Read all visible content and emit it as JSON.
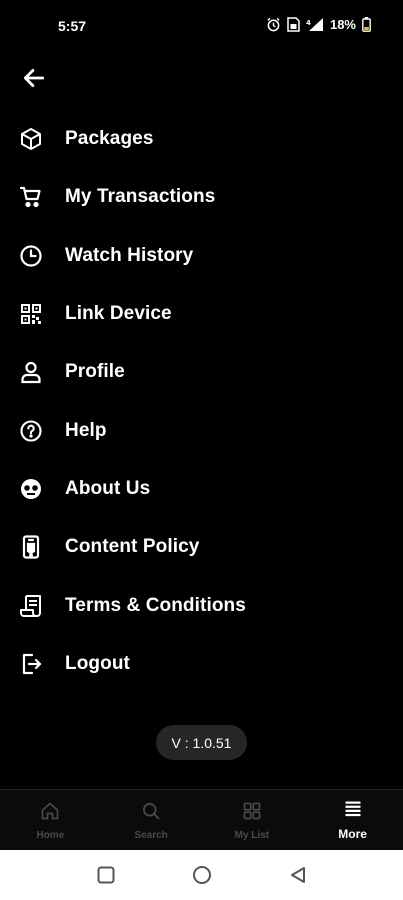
{
  "status_bar": {
    "time": "5:57",
    "battery": "18%"
  },
  "menu": {
    "items": [
      {
        "label": "Packages",
        "icon": "package-icon"
      },
      {
        "label": "My Transactions",
        "icon": "cart-icon"
      },
      {
        "label": "Watch History",
        "icon": "clock-icon"
      },
      {
        "label": "Link Device",
        "icon": "qr-code-icon"
      },
      {
        "label": "Profile",
        "icon": "user-icon"
      },
      {
        "label": "Help",
        "icon": "help-circle-icon"
      },
      {
        "label": "About Us",
        "icon": "about-icon"
      },
      {
        "label": "Content Policy",
        "icon": "phone-document-icon"
      },
      {
        "label": "Terms & Conditions",
        "icon": "scroll-icon"
      },
      {
        "label": "Logout",
        "icon": "logout-icon"
      }
    ]
  },
  "version": "V : 1.0.51",
  "bottom_nav": {
    "items": [
      {
        "label": "Home",
        "icon": "home-icon"
      },
      {
        "label": "Search",
        "icon": "search-icon"
      },
      {
        "label": "My List",
        "icon": "grid-icon"
      },
      {
        "label": "More",
        "icon": "list-icon",
        "active": true
      }
    ]
  },
  "colors": {
    "background": "#000000",
    "text": "#ffffff",
    "inactive_nav": "#4a4a4a",
    "version_pill": "#262626"
  }
}
